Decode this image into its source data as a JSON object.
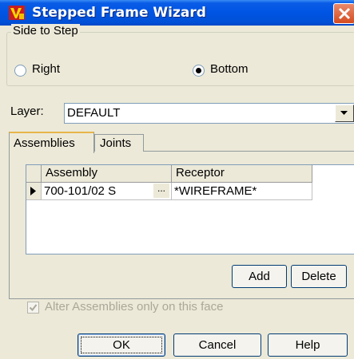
{
  "window": {
    "title": "Stepped Frame Wizard"
  },
  "side_group": {
    "label": "Side to Step",
    "options": [
      {
        "label": "Right",
        "checked": false
      },
      {
        "label": "Bottom",
        "checked": true
      }
    ]
  },
  "layer": {
    "label": "Layer:",
    "value": "DEFAULT"
  },
  "tabs": [
    {
      "label": "Assemblies",
      "active": true
    },
    {
      "label": "Joints",
      "active": false
    }
  ],
  "grid": {
    "columns": [
      "Assembly",
      "Receptor"
    ],
    "rows": [
      {
        "assembly": "700-101/02 S",
        "ellipsis": "...",
        "receptor": "*WIREFRAME*"
      }
    ]
  },
  "grid_buttons": {
    "add": "Add",
    "delete": "Delete"
  },
  "alter_checkbox": {
    "label": "Alter Assemblies only on this face",
    "checked": true,
    "enabled": false
  },
  "footer": {
    "ok": "OK",
    "cancel": "Cancel",
    "help": "Help"
  },
  "colors": {
    "titlebar": "#0054e3",
    "face": "#ece9d8",
    "close": "#d54b1f"
  },
  "icons": [
    "app-icon",
    "close-icon",
    "chevron-down-icon",
    "row-pointer-icon",
    "check-icon"
  ]
}
